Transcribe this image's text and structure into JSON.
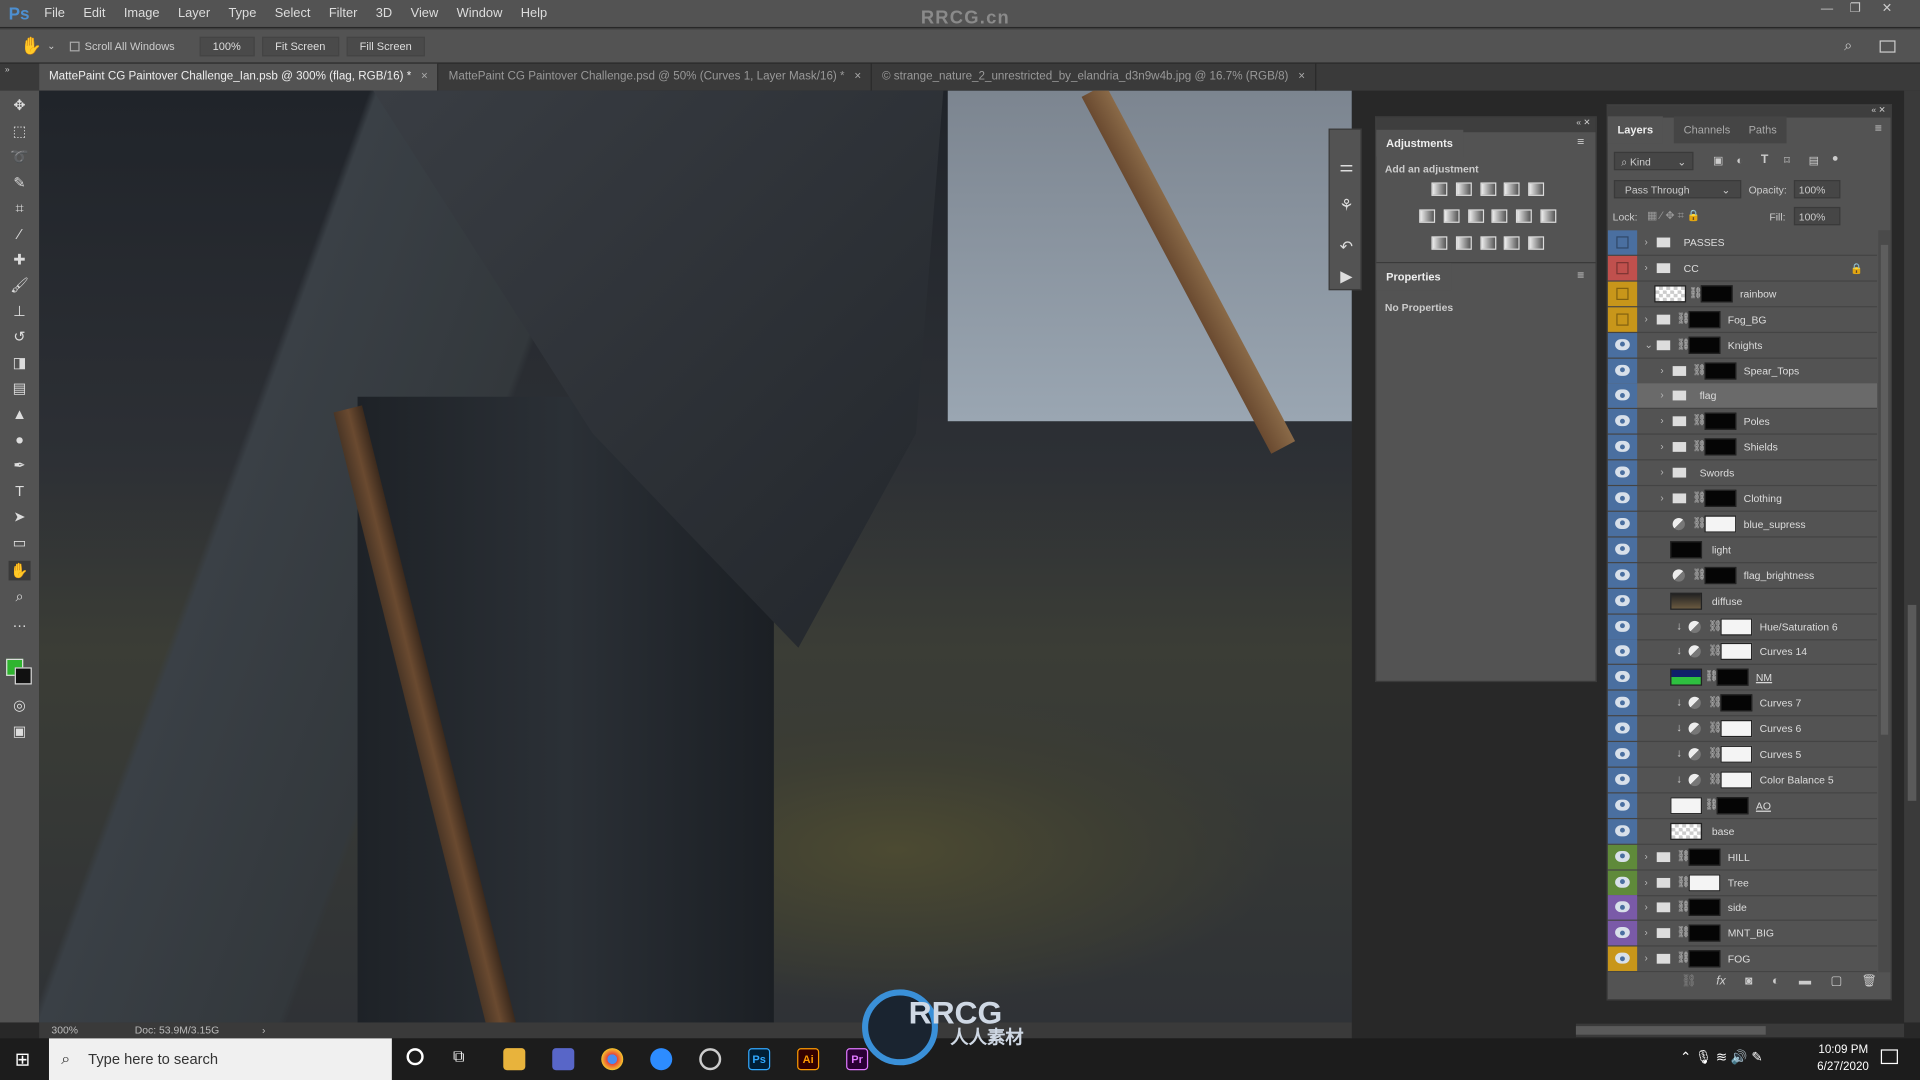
{
  "app": {
    "logo": "Ps",
    "watermark": "RRCG.cn"
  },
  "menu": [
    "File",
    "Edit",
    "Image",
    "Layer",
    "Type",
    "Select",
    "Filter",
    "3D",
    "View",
    "Window",
    "Help"
  ],
  "window_controls": {
    "minimize": "—",
    "restore": "❐",
    "close": "✕"
  },
  "options": {
    "tool_icon": "hand-icon",
    "scroll_all": "Scroll All Windows",
    "scroll_all_checked": false,
    "zoom_100": "100%",
    "fit_screen": "Fit Screen",
    "fill_screen": "Fill Screen"
  },
  "tabs": [
    {
      "label": "MattePaint CG Paintover Challenge_Ian.psb @ 300% (flag, RGB/16) *",
      "active": true
    },
    {
      "label": "MattePaint CG Paintover Challenge.psd @ 50% (Curves 1, Layer Mask/16) *",
      "active": false
    },
    {
      "label": "© strange_nature_2_unrestricted_by_elandria_d3n9w4b.jpg @ 16.7% (RGB/8)",
      "active": false
    }
  ],
  "tab_close": "×",
  "status": {
    "zoom": "300%",
    "doc": "Doc: 53.9M/3.15G"
  },
  "canvas_watermark": {
    "title": "RRCG",
    "subtitle": "人人素材"
  },
  "adjustments": {
    "title": "Adjustments",
    "subtitle": "Add an adjustment"
  },
  "properties": {
    "title": "Properties",
    "body": "No Properties"
  },
  "layers_panel": {
    "tabs": [
      "Layers",
      "Channels",
      "Paths"
    ],
    "filter": "Kind",
    "blend_mode": "Pass Through",
    "opacity_label": "Opacity:",
    "opacity": "100%",
    "lock_label": "Lock:",
    "fill_label": "Fill:",
    "fill": "100%",
    "tag_colors": {
      "blue": "#4a6fa0",
      "red": "#c0504d",
      "yellow": "#c8961a",
      "green": "#5f8a3a",
      "violet": "#7a5aa8",
      "none": "transparent"
    },
    "layers": [
      {
        "name": "PASSES",
        "tag": "blue",
        "visible": false,
        "kind": "group",
        "indent": 0,
        "expanded": false
      },
      {
        "name": "CC",
        "tag": "red",
        "visible": false,
        "kind": "group",
        "indent": 0,
        "expanded": false,
        "locked": true
      },
      {
        "name": "rainbow",
        "tag": "yellow",
        "visible": false,
        "kind": "layer",
        "indent": 0,
        "thumb": "checker",
        "mask": "black"
      },
      {
        "name": "Fog_BG",
        "tag": "yellow",
        "visible": false,
        "kind": "group",
        "indent": 0,
        "expanded": false,
        "mask": "black"
      },
      {
        "name": "Knights",
        "tag": "blue",
        "visible": true,
        "kind": "group",
        "indent": 0,
        "expanded": true,
        "mask": "black"
      },
      {
        "name": "Spear_Tops",
        "tag": "blue",
        "visible": true,
        "kind": "group",
        "indent": 1,
        "expanded": false,
        "mask": "black"
      },
      {
        "name": "flag",
        "tag": "blue",
        "visible": true,
        "kind": "group",
        "indent": 1,
        "expanded": false,
        "selected": true
      },
      {
        "name": "Poles",
        "tag": "blue",
        "visible": true,
        "kind": "group",
        "indent": 1,
        "expanded": false,
        "mask": "black"
      },
      {
        "name": "Shields",
        "tag": "blue",
        "visible": true,
        "kind": "group",
        "indent": 1,
        "expanded": false,
        "mask": "black"
      },
      {
        "name": "Swords",
        "tag": "blue",
        "visible": true,
        "kind": "group",
        "indent": 1,
        "expanded": false
      },
      {
        "name": "Clothing",
        "tag": "blue",
        "visible": true,
        "kind": "group",
        "indent": 1,
        "expanded": false,
        "mask": "black"
      },
      {
        "name": "blue_supress",
        "tag": "blue",
        "visible": true,
        "kind": "adjustment",
        "indent": 1,
        "mask": "white"
      },
      {
        "name": "light",
        "tag": "blue",
        "visible": true,
        "kind": "layer",
        "indent": 1,
        "thumb": "black"
      },
      {
        "name": "flag_brightness",
        "tag": "blue",
        "visible": true,
        "kind": "adjustment",
        "indent": 1,
        "mask": "black"
      },
      {
        "name": "diffuse",
        "tag": "blue",
        "visible": true,
        "kind": "layer",
        "indent": 1,
        "thumb": "image"
      },
      {
        "name": "Hue/Saturation 6",
        "tag": "blue",
        "visible": true,
        "kind": "adjustment",
        "indent": 1,
        "clipped": true,
        "mask": "white"
      },
      {
        "name": "Curves 14",
        "tag": "blue",
        "visible": true,
        "kind": "adjustment",
        "indent": 1,
        "clipped": true,
        "mask": "white"
      },
      {
        "name": "NM",
        "tag": "blue",
        "visible": true,
        "kind": "layer",
        "indent": 1,
        "thumb": "normal",
        "mask": "black",
        "underline": true
      },
      {
        "name": "Curves 7",
        "tag": "blue",
        "visible": true,
        "kind": "adjustment",
        "indent": 1,
        "clipped": true,
        "mask": "black"
      },
      {
        "name": "Curves 6",
        "tag": "blue",
        "visible": true,
        "kind": "adjustment",
        "indent": 1,
        "clipped": true,
        "mask": "white"
      },
      {
        "name": "Curves 5",
        "tag": "blue",
        "visible": true,
        "kind": "adjustment",
        "indent": 1,
        "clipped": true,
        "mask": "white"
      },
      {
        "name": "Color Balance 5",
        "tag": "blue",
        "visible": true,
        "kind": "adjustment",
        "indent": 1,
        "clipped": true,
        "mask": "white"
      },
      {
        "name": "AO",
        "tag": "blue",
        "visible": true,
        "kind": "layer",
        "indent": 1,
        "thumb": "white",
        "mask": "black",
        "underline": true
      },
      {
        "name": "base",
        "tag": "blue",
        "visible": true,
        "kind": "layer",
        "indent": 1,
        "thumb": "checker"
      },
      {
        "name": "HILL",
        "tag": "green",
        "visible": true,
        "kind": "group",
        "indent": 0,
        "expanded": false,
        "mask": "black"
      },
      {
        "name": "Tree",
        "tag": "green",
        "visible": true,
        "kind": "group",
        "indent": 0,
        "expanded": false,
        "mask": "white"
      },
      {
        "name": "side",
        "tag": "violet",
        "visible": true,
        "kind": "group",
        "indent": 0,
        "expanded": false,
        "mask": "black"
      },
      {
        "name": "MNT_BIG",
        "tag": "violet",
        "visible": true,
        "kind": "group",
        "indent": 0,
        "expanded": false,
        "mask": "black"
      },
      {
        "name": "FOG",
        "tag": "yellow",
        "visible": true,
        "kind": "group",
        "indent": 0,
        "expanded": false,
        "mask": "black"
      }
    ],
    "footer_icons": [
      "link-icon",
      "fx-icon",
      "mask-icon",
      "adjustment-icon",
      "folder-icon",
      "new-layer-icon",
      "trash-icon"
    ]
  },
  "taskbar": {
    "search_placeholder": "Type here to search",
    "time": "10:09 PM",
    "date": "6/27/2020"
  },
  "colors": {
    "foreground": "#2fb52f",
    "background": "#111111"
  }
}
